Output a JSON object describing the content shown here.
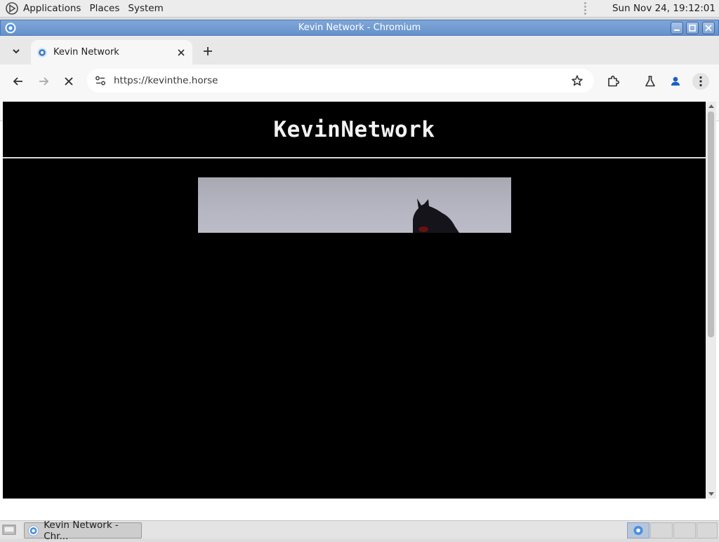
{
  "top_panel": {
    "menus": [
      "Applications",
      "Places",
      "System"
    ],
    "clock": "Sun Nov 24, 19:12:01"
  },
  "window": {
    "title": "Kevin Network - Chromium"
  },
  "browser": {
    "tab": {
      "title": "Kevin Network"
    },
    "omnibox": {
      "url": "https://kevinthe.horse"
    }
  },
  "page": {
    "site_title": "KevinNetwork"
  },
  "taskbar": {
    "task_label": "Kevin Network - Chr..."
  },
  "colors": {
    "page_background": "#000000",
    "title_bar": "#6d98d0",
    "profile_accent": "#1a73e8"
  }
}
